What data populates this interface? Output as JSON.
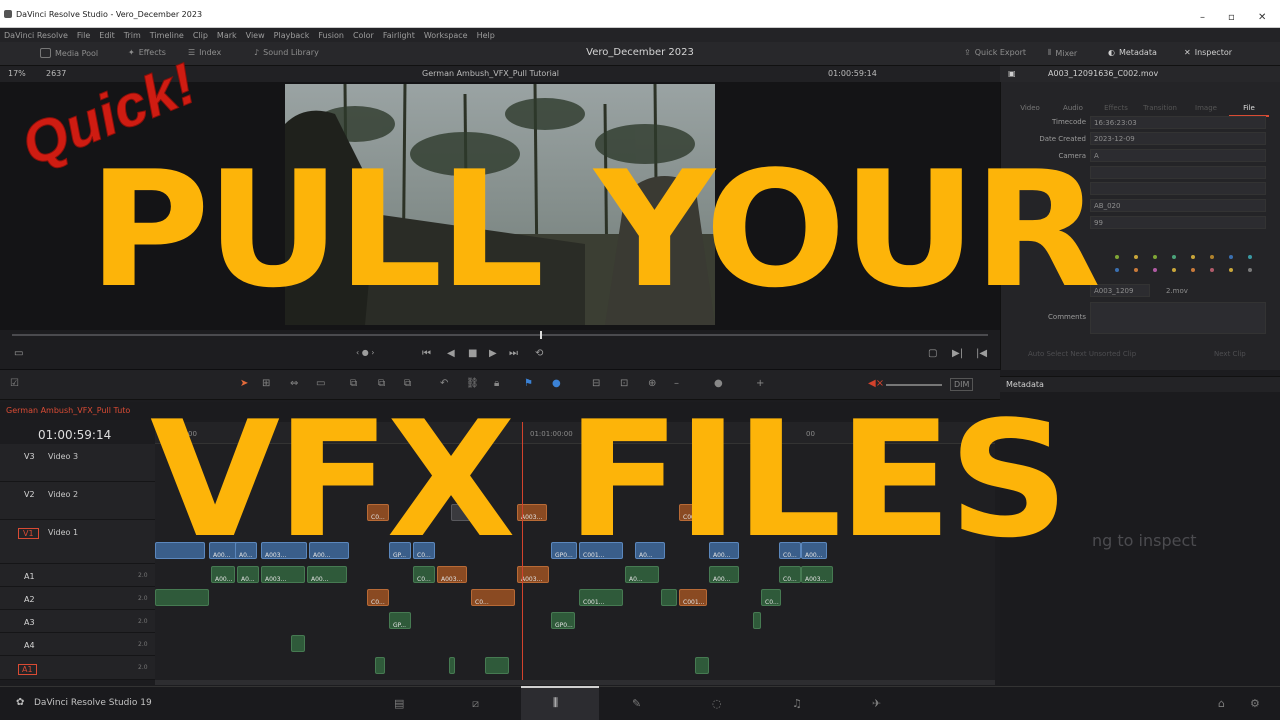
{
  "window": {
    "title": "DaVinci Resolve Studio - Vero_December 2023"
  },
  "menu": [
    "DaVinci Resolve",
    "File",
    "Edit",
    "Trim",
    "Timeline",
    "Clip",
    "Mark",
    "View",
    "Playback",
    "Fusion",
    "Color",
    "Fairlight",
    "Workspace",
    "Help"
  ],
  "toolbar": {
    "media_pool": "Media Pool",
    "effects": "Effects",
    "index": "Index",
    "sound_library": "Sound Library",
    "project_title": "Vero_December 2023",
    "quick_export": "Quick Export",
    "mixer": "Mixer",
    "metadata": "Metadata",
    "inspector": "Inspector"
  },
  "viewer": {
    "zoom": "17%",
    "frame_count": "2637",
    "timeline_name": "German Ambush_VFX_Pull Tutorial",
    "timecode": "01:00:59:14"
  },
  "inspector": {
    "clip_name": "A003_12091636_C002.mov",
    "tabs": [
      "Video",
      "Audio",
      "Effects",
      "Transition",
      "Image",
      "File"
    ],
    "active_tab": "File",
    "fields": [
      {
        "label": "Timecode",
        "value": "16:36:23:03"
      },
      {
        "label": "Date Created",
        "value": "2023-12-09"
      },
      {
        "label": "Camera",
        "value": "A"
      }
    ],
    "reel_value": "AB_020",
    "take_value": "99",
    "file_value": "A003_1209",
    "file_value_tail": "2.mov",
    "comments_label": "Comments",
    "auto_select": "Auto Select Next Unsorted Clip",
    "next_clip": "Next Clip"
  },
  "metadata": {
    "header": "Metadata",
    "empty_text": "ng to inspect"
  },
  "timeline": {
    "tab_name": "German Ambush_VFX_Pull Tuto",
    "timecode": "01:00:59:14",
    "ruler_ticks": [
      "00",
      "01:01:00:00",
      "00"
    ],
    "tracks": [
      {
        "tag": "V3",
        "name": "Video 3"
      },
      {
        "tag": "V2",
        "name": "Video 2"
      },
      {
        "tag": "V1",
        "name": "Video 1"
      }
    ],
    "audio_tracks": [
      {
        "tag": "A1",
        "level": "2.0"
      },
      {
        "tag": "A2",
        "level": "2.0"
      },
      {
        "tag": "A3",
        "level": "2.0"
      },
      {
        "tag": "A4",
        "level": "2.0"
      },
      {
        "tag": "A1",
        "level": "2.0"
      }
    ],
    "clip_labels": {
      "v1": [
        "A00...",
        "A0...",
        "A003...",
        "A00...",
        "GP...",
        "C0...",
        "GP0...",
        "C001...",
        "A0...",
        "A00...",
        "C0...",
        "A00..."
      ],
      "v2": [
        "C0...",
        "A003...",
        "C001..."
      ],
      "a1": [
        "A00...",
        "A0...",
        "A003...",
        "A00...",
        "C0...",
        "A003...",
        "A003...",
        "A0...",
        "A00...",
        "C0...",
        "A003..."
      ],
      "a2": [
        "C0...",
        "C0...",
        "C001...",
        "C001...",
        "C0..."
      ],
      "a3": [
        "GP...",
        "GP0..."
      ]
    },
    "dim": "DIM"
  },
  "pagebar": {
    "app_name": "DaVinci Resolve Studio 19"
  },
  "overlay": {
    "quick": "Quick!",
    "line1": "PULL YOUR",
    "line2": "VFX FILES"
  },
  "colors": {
    "overlay_yellow": "#fdb409",
    "quick_red": "#cf1c12",
    "playhead": "#d3422c",
    "video_clip": "#3a5e8a",
    "orange_clip": "#8a4a22",
    "audio_clip": "#2f5a3a"
  }
}
